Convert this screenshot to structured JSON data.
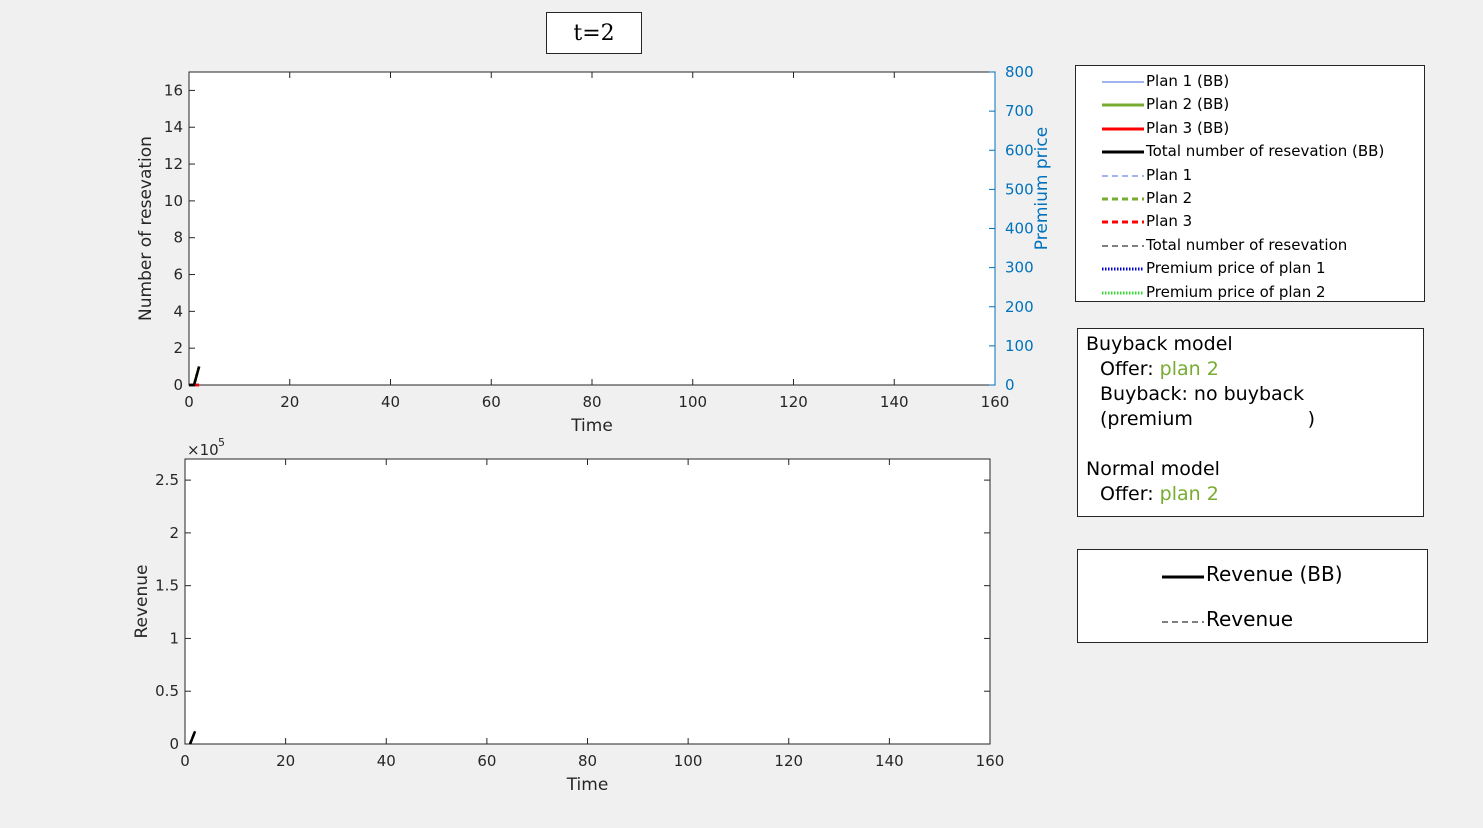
{
  "figure_title": "t=2",
  "legend_top": [
    {
      "label": "Plan 1 (BB)",
      "color": "#4169e1",
      "style": "solid",
      "width": 1
    },
    {
      "label": "Plan 2 (BB)",
      "color": "#77ac30",
      "style": "solid",
      "width": 3
    },
    {
      "label": "Plan 3 (BB)",
      "color": "#ff0000",
      "style": "solid",
      "width": 3
    },
    {
      "label": "Total number of resevation (BB)",
      "color": "#000000",
      "style": "solid",
      "width": 3
    },
    {
      "label": "Plan 1",
      "color": "#4169e1",
      "style": "dashed",
      "width": 1
    },
    {
      "label": "Plan 2",
      "color": "#77ac30",
      "style": "dashed",
      "width": 3
    },
    {
      "label": "Plan 3",
      "color": "#ff0000",
      "style": "dashed",
      "width": 3
    },
    {
      "label": "Total number of resevation",
      "color": "#000000",
      "style": "dashed",
      "width": 1
    },
    {
      "label": "Premium price of plan 1",
      "color": "#0000cd",
      "style": "dotted",
      "width": 3
    },
    {
      "label": "Premium price of plan 2",
      "color": "#33dd33",
      "style": "dotted",
      "width": 3
    }
  ],
  "info_box": {
    "buyback_title": "Buyback model",
    "offer_label": "Offer: ",
    "buyback_offer": "plan 2",
    "buyback_label": "Buyback: no buyback",
    "premium_label": "(premium                   )",
    "normal_title": "Normal model",
    "normal_offer": "plan 2"
  },
  "legend_bottom": [
    {
      "label": "Revenue (BB)",
      "color": "#000000",
      "style": "solid",
      "width": 3
    },
    {
      "label": "Revenue",
      "color": "#000000",
      "style": "dashed",
      "width": 1
    }
  ],
  "chart_data": [
    {
      "type": "line",
      "xlabel": "Time",
      "ylabel": "Number of resevation",
      "y2label": "Premium price",
      "xlim": [
        0,
        160
      ],
      "ylim": [
        0,
        17
      ],
      "y2lim": [
        0,
        800
      ],
      "xticks": [
        0,
        20,
        40,
        60,
        80,
        100,
        120,
        140,
        160
      ],
      "yticks": [
        0,
        2,
        4,
        6,
        8,
        10,
        12,
        14,
        16
      ],
      "y2ticks": [
        0,
        100,
        200,
        300,
        400,
        500,
        600,
        700,
        800
      ],
      "axis_color_right": "#0072bd",
      "grid": false,
      "series": [
        {
          "name": "Plan 1 (BB)",
          "color": "#4169e1",
          "x": [
            0,
            1,
            2
          ],
          "y": [
            0,
            0,
            0
          ]
        },
        {
          "name": "Plan 2 (BB)",
          "color": "#77ac30",
          "x": [
            0,
            1,
            2
          ],
          "y": [
            0,
            0,
            1
          ]
        },
        {
          "name": "Plan 3 (BB)",
          "color": "#ff0000",
          "x": [
            0,
            1,
            2
          ],
          "y": [
            0,
            0,
            0
          ]
        },
        {
          "name": "Total number of resevation (BB)",
          "color": "#000000",
          "x": [
            0,
            1,
            2
          ],
          "y": [
            0,
            0,
            1
          ]
        },
        {
          "name": "Plan 1",
          "color": "#4169e1",
          "x": [
            0,
            1,
            2
          ],
          "y": [
            0,
            0,
            0
          ]
        },
        {
          "name": "Plan 2",
          "color": "#77ac30",
          "x": [
            0,
            1,
            2
          ],
          "y": [
            0,
            0,
            1
          ]
        },
        {
          "name": "Plan 3",
          "color": "#ff0000",
          "x": [
            0,
            1,
            2
          ],
          "y": [
            0,
            0,
            0
          ]
        },
        {
          "name": "Total number of resevation",
          "color": "#000000",
          "x": [
            0,
            1,
            2
          ],
          "y": [
            0,
            0,
            1
          ]
        }
      ]
    },
    {
      "type": "line",
      "xlabel": "Time",
      "ylabel": "Revenue",
      "y_exponent": "10",
      "y_exponent_power": "5",
      "xlim": [
        0,
        160
      ],
      "ylim": [
        0,
        2.7
      ],
      "xticks": [
        0,
        20,
        40,
        60,
        80,
        100,
        120,
        140,
        160
      ],
      "yticks": [
        0,
        0.5,
        1,
        1.5,
        2,
        2.5
      ],
      "grid": false,
      "series": [
        {
          "name": "Revenue (BB)",
          "color": "#000000",
          "x": [
            1,
            2
          ],
          "y": [
            0,
            0.12
          ]
        },
        {
          "name": "Revenue",
          "color": "#000000",
          "x": [
            1,
            2
          ],
          "y": [
            0,
            0.12
          ]
        }
      ]
    }
  ]
}
